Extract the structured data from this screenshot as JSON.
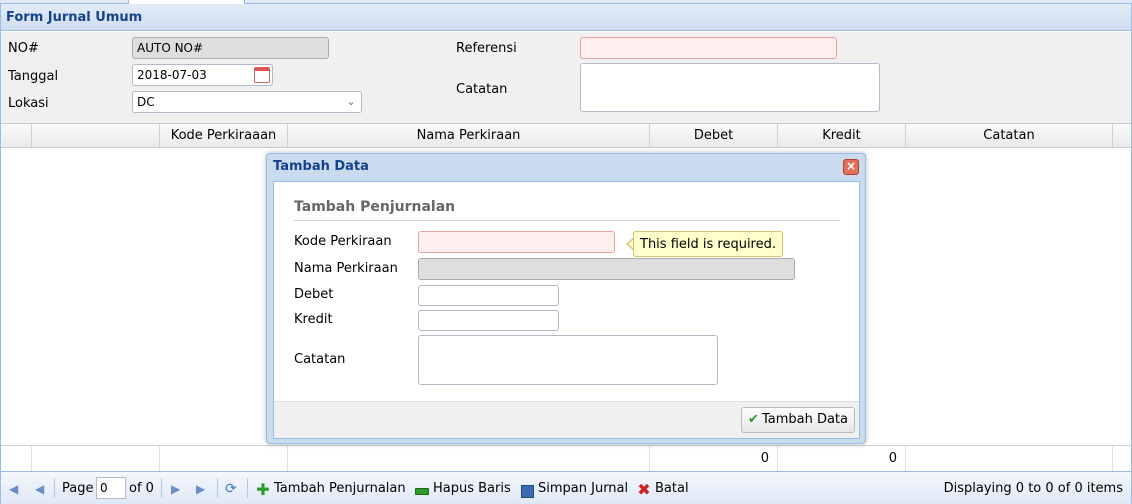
{
  "panel": {
    "title": "Form Jurnal Umum"
  },
  "form": {
    "no_label": "NO#",
    "no_value": "AUTO NO#",
    "tanggal_label": "Tanggal",
    "tanggal_value": "2018-07-03",
    "lokasi_label": "Lokasi",
    "lokasi_value": "DC",
    "referensi_label": "Referensi",
    "referensi_value": "",
    "catatan_label": "Catatan",
    "catatan_value": ""
  },
  "grid": {
    "columns": [
      "Kode Perkiraaan",
      "Nama Perkiraan",
      "Debet",
      "Kredit",
      "Catatan"
    ],
    "summary": {
      "debet": "0",
      "kredit": "0"
    }
  },
  "paging": {
    "page_label": "Page",
    "page_value": "0",
    "of_label": "of 0",
    "tambah_label": "Tambah Penjurnalan",
    "hapus_label": "Hapus Baris",
    "simpan_label": "Simpan Jurnal",
    "batal_label": "Batal",
    "display_text": "Displaying 0 to 0 of 0 items"
  },
  "modal": {
    "title": "Tambah Data",
    "fieldset_title": "Tambah Penjurnalan",
    "kode_label": "Kode Perkiraan",
    "nama_label": "Nama Perkiraan",
    "debet_label": "Debet",
    "kredit_label": "Kredit",
    "catatan_label": "Catatan",
    "error_tooltip": "This field is required.",
    "submit_label": "Tambah Data"
  },
  "colors": {
    "header_text": "#15428b",
    "border": "#99bbe8",
    "invalid_bg": "#fff0f0"
  },
  "icons": [
    "calendar-icon",
    "chevron-down-icon",
    "first-page-icon",
    "prev-page-icon",
    "next-page-icon",
    "last-page-icon",
    "refresh-icon",
    "add-icon",
    "remove-icon",
    "save-icon",
    "cancel-icon",
    "close-icon",
    "check-icon"
  ]
}
